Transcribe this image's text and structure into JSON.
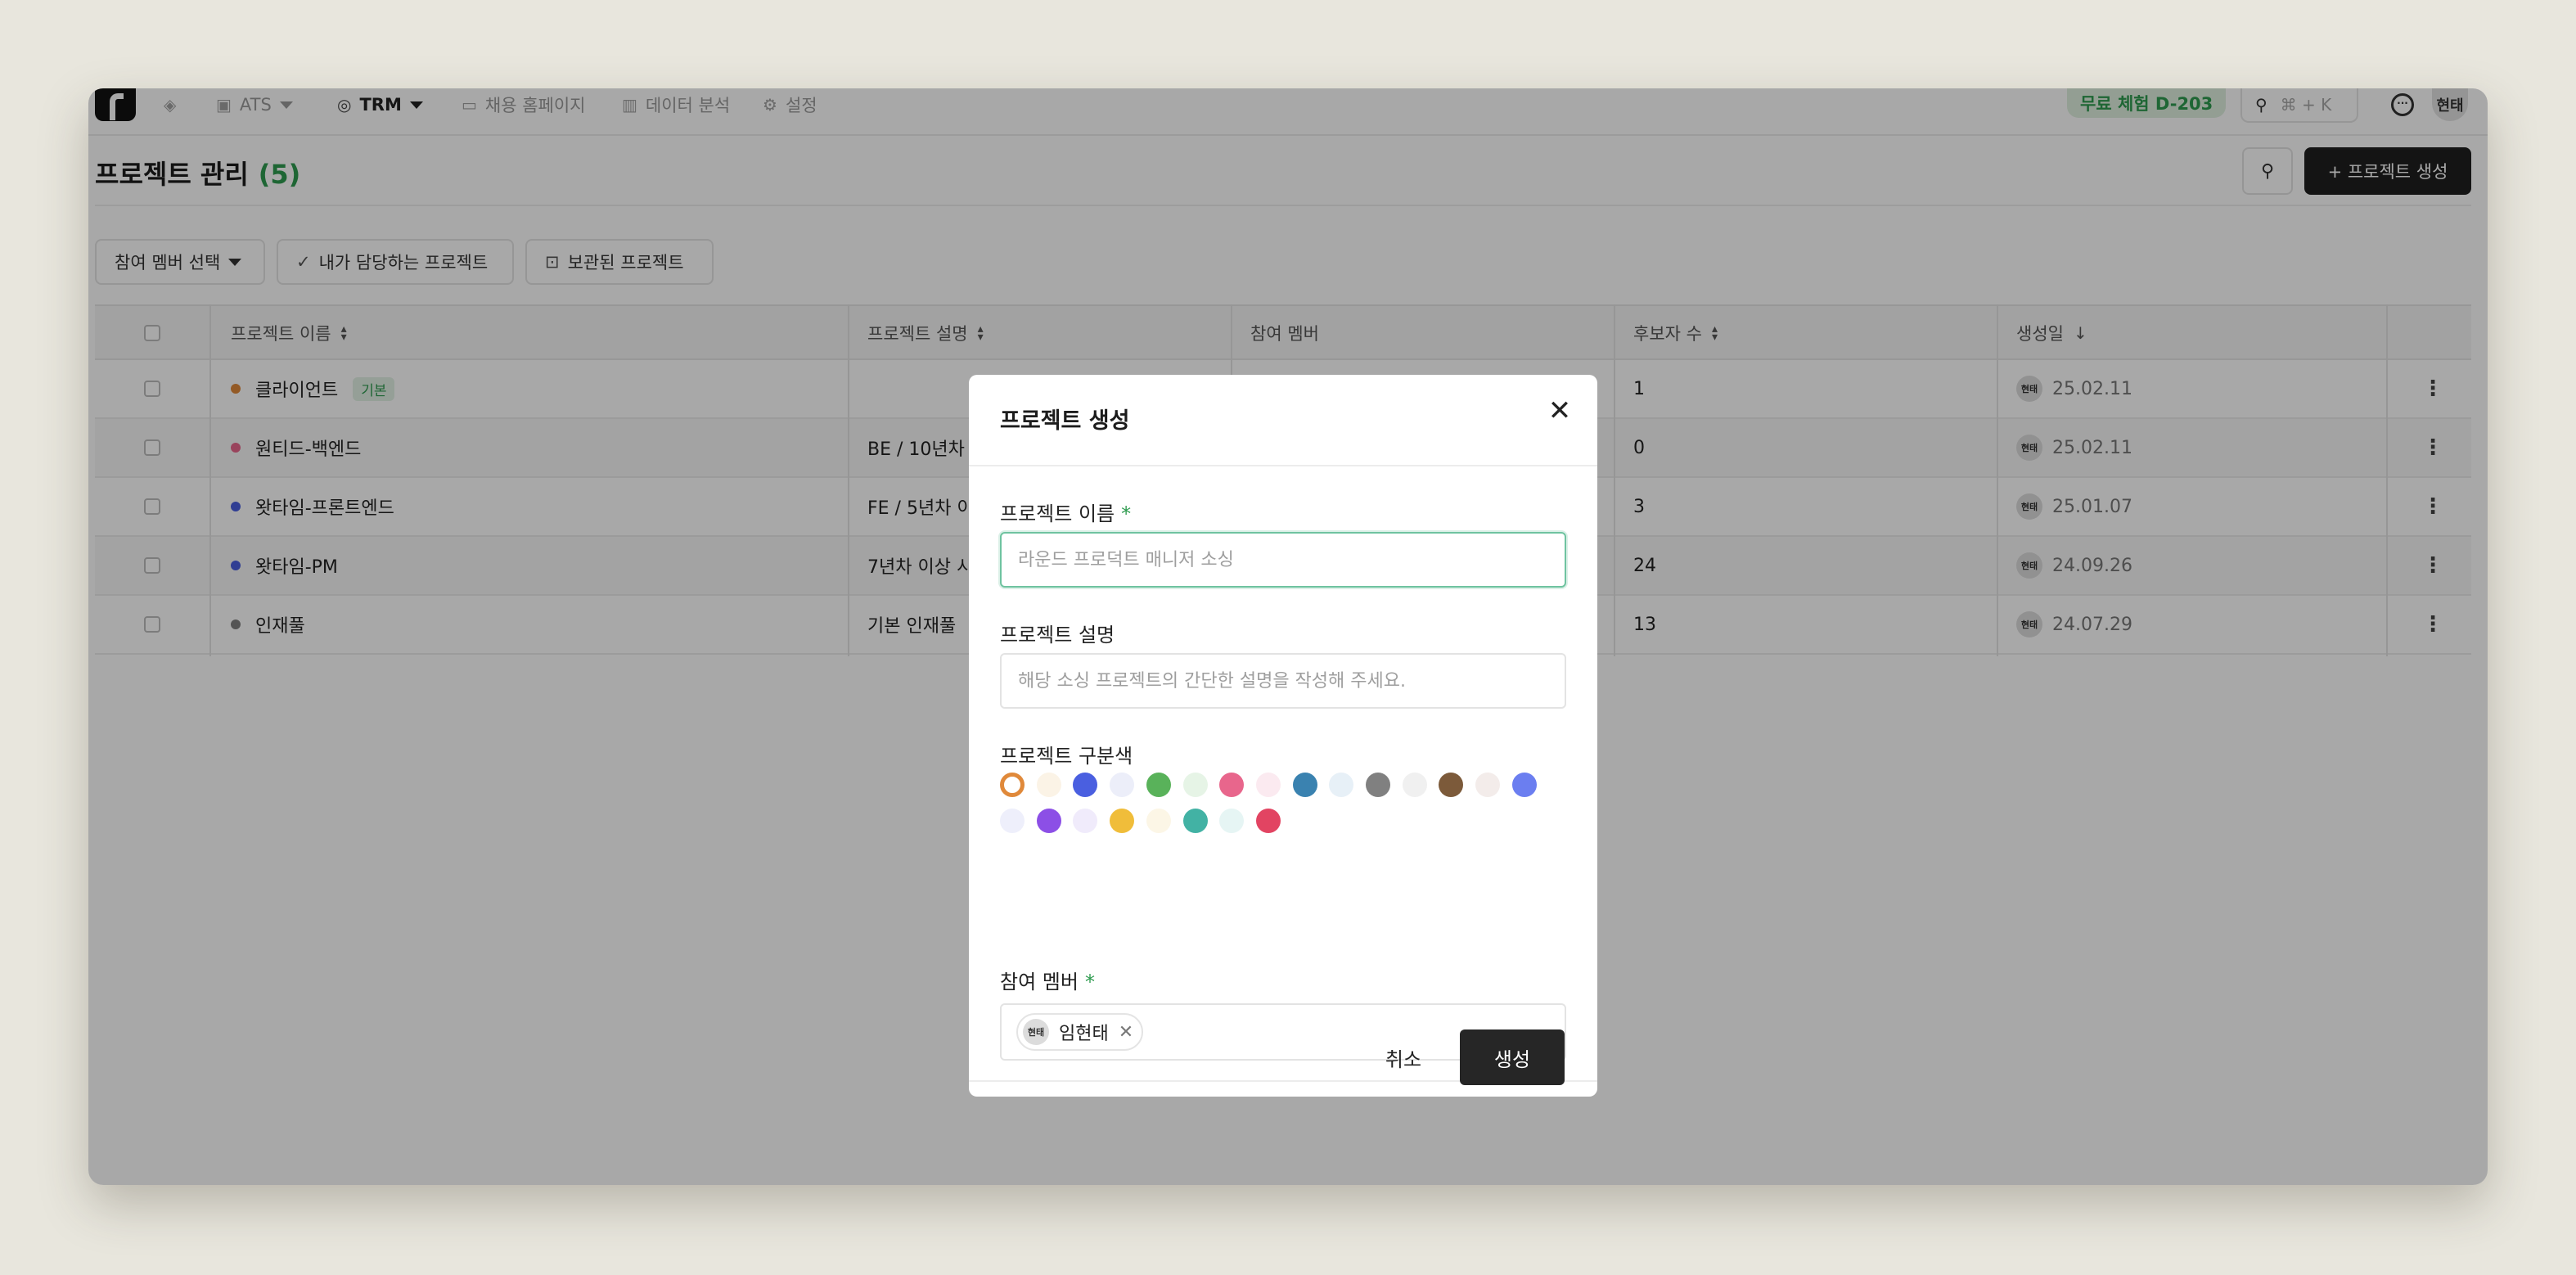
{
  "nav": {
    "items": [
      {
        "icon": "layers-icon",
        "glyph": "◈",
        "label": ""
      },
      {
        "icon": "briefcase-icon",
        "glyph": "▣",
        "label": "ATS"
      },
      {
        "icon": "database-icon",
        "glyph": "◎",
        "label": "TRM"
      },
      {
        "icon": "homepage-icon",
        "glyph": "▭",
        "label": "채용 홈페이지"
      },
      {
        "icon": "chart-icon",
        "glyph": "▥",
        "label": "데이터 분석"
      },
      {
        "icon": "gear-icon",
        "glyph": "⚙",
        "label": "설정"
      }
    ],
    "trial_badge": "무료 체험 D-203",
    "search_shortcut": "⌘ + K",
    "user_avatar": "현태"
  },
  "page": {
    "title": "프로젝트 관리",
    "count": "(5)",
    "create_button": "+ 프로젝트 생성"
  },
  "filters": {
    "member_select": "참여 멤버 선택",
    "my_projects": "내가 담당하는 프로젝트",
    "archived": "보관된 프로젝트"
  },
  "table": {
    "headers": {
      "name": "프로젝트 이름",
      "description": "프로젝트 설명",
      "members": "참여 멤버",
      "candidates": "후보자 수",
      "created": "생성일"
    },
    "default_tag": "기본",
    "rows": [
      {
        "color": "#e0893a",
        "name": "클라이언트",
        "is_default": true,
        "description": "",
        "candidates": "1",
        "avatar": "현태",
        "created": "25.02.11"
      },
      {
        "color": "#e8668c",
        "name": "원티드-백엔드",
        "is_default": false,
        "description": "BE / 10년차 이",
        "candidates": "0",
        "avatar": "현태",
        "created": "25.02.11"
      },
      {
        "color": "#4a5fe0",
        "name": "왓타임-프론트엔드",
        "is_default": false,
        "description": "FE / 5년차 이",
        "candidates": "3",
        "avatar": "현태",
        "created": "25.01.07"
      },
      {
        "color": "#4a5fe0",
        "name": "왓타임-PM",
        "is_default": false,
        "description": "7년차 이상 시",
        "candidates": "24",
        "avatar": "현태",
        "created": "24.09.26"
      },
      {
        "color": "#808080",
        "name": "인재풀",
        "is_default": false,
        "description": "기본 인재풀",
        "candidates": "13",
        "avatar": "현태",
        "created": "24.07.29"
      }
    ]
  },
  "modal": {
    "title": "프로젝트 생성",
    "name_label": "프로젝트 이름",
    "required_mark": "*",
    "name_placeholder": "라운드 프로덕트 매니저 소싱",
    "name_value": "",
    "desc_label": "프로젝트 설명",
    "desc_placeholder": "해당 소싱 프로젝트의 간단한 설명을 작성해 주세요.",
    "desc_value": "",
    "color_label": "프로젝트 구분색",
    "colors": [
      "#e0893a",
      "#fbf3e6",
      "#4a5fe0",
      "#eceef9",
      "#59b25a",
      "#e6f4e6",
      "#e8668c",
      "#fbeaf0",
      "#3a82b0",
      "#e7f0f7",
      "#808080",
      "#f0f0f0",
      "#7c5a3a",
      "#f3ecea",
      "#6b7ef0",
      "#eeeffb",
      "#8c4fe6",
      "#f0ebfb",
      "#f0bd3a",
      "#fcf6e6",
      "#42b2a4",
      "#e6f5f4",
      "#e24462"
    ],
    "selected_color": "#e0893a",
    "members_label": "참여 멤버",
    "member_chip_avatar": "현태",
    "member_chip_name": "임현태",
    "cancel": "취소",
    "submit": "생성"
  }
}
